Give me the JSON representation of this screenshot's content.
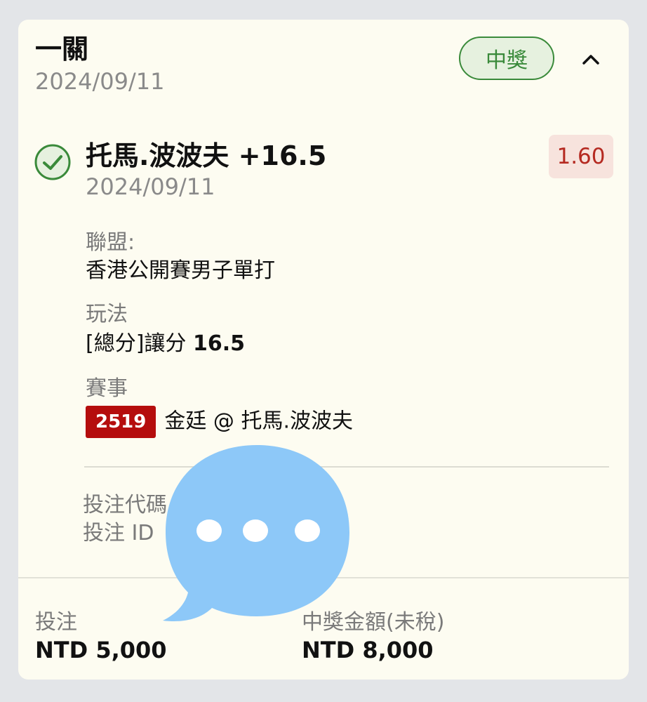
{
  "header": {
    "title": "一關",
    "date": "2024/09/11",
    "status_badge": "中獎"
  },
  "selection": {
    "pick": "托馬.波波夫 +16.5",
    "date": "2024/09/11",
    "odds": "1.60",
    "league_label": "聯盟:",
    "league_value": "香港公開賽男子單打",
    "play_label": "玩法",
    "play_value_prefix": "[總分]讓分",
    "play_value_number": "16.5",
    "event_label": "賽事",
    "event_number": "2519",
    "event_name": "金廷 @ 托馬.波波夫"
  },
  "bet_info": {
    "code_label": "投注代碼",
    "id_label": "投注 ID"
  },
  "footer": {
    "stake_label": "投注",
    "stake_value": "NTD 5,000",
    "payout_label": "中獎金額(未稅)",
    "payout_value": "NTD 8,000"
  },
  "icons": {
    "check": "check-circle-icon",
    "collapse": "chevron-up-icon",
    "overlay": "chat-bubble-icon"
  },
  "colors": {
    "win_green": "#3a8a3a",
    "odds_red": "#b52a21",
    "event_badge": "#b50d0d",
    "bubble_blue": "#8dc8f8"
  }
}
